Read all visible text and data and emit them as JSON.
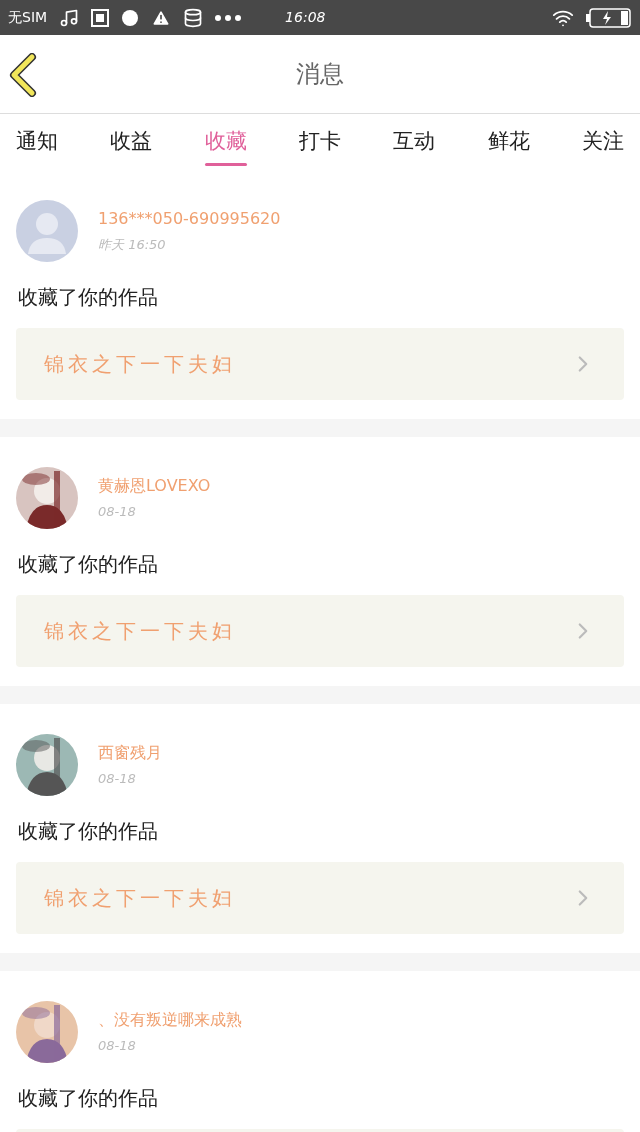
{
  "status_bar": {
    "carrier": "无SIM",
    "time": "16:08"
  },
  "header": {
    "title": "消息"
  },
  "tabs": [
    {
      "label": "通知",
      "selected": false
    },
    {
      "label": "收益",
      "selected": false
    },
    {
      "label": "收藏",
      "selected": true
    },
    {
      "label": "打卡",
      "selected": false
    },
    {
      "label": "互动",
      "selected": false
    },
    {
      "label": "鲜花",
      "selected": false
    },
    {
      "label": "关注",
      "selected": false
    }
  ],
  "messages": [
    {
      "avatar": {
        "kind": "default"
      },
      "name": "136***050-690995620",
      "time": "昨天 16:50",
      "text": "收藏了你的作品",
      "work": "锦衣之下一下夫妇"
    },
    {
      "name": "黄赫恩LOVEXO",
      "time": "08-18",
      "text": "收藏了你的作品",
      "work": "锦衣之下一下夫妇"
    },
    {
      "name": "西窗残月",
      "time": "08-18",
      "text": "收藏了你的作品",
      "work": "锦衣之下一下夫妇"
    },
    {
      "name": "、没有叛逆哪来成熟",
      "time": "08-18",
      "text": "收藏了你的作品"
    }
  ]
}
